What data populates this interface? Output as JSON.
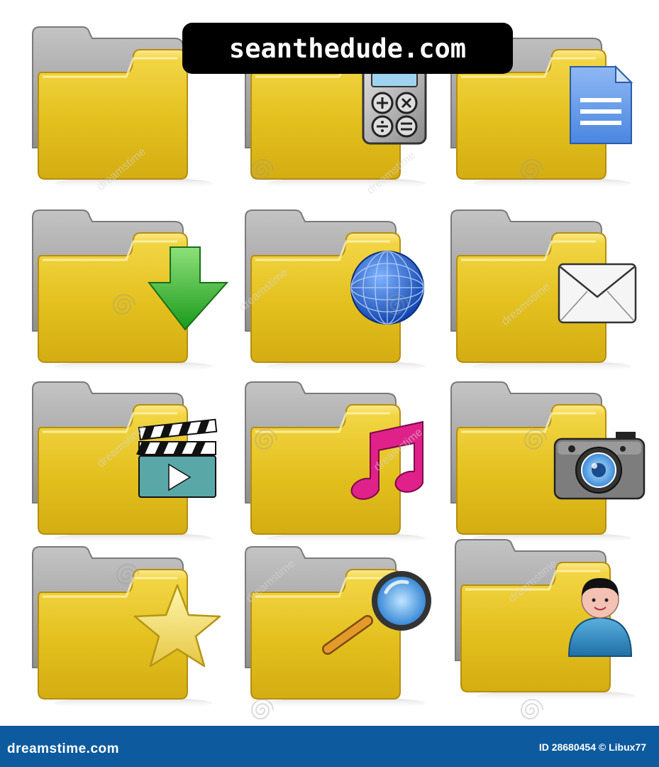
{
  "banner": {
    "text": "seanthedude.com"
  },
  "watermark": {
    "text": "dreamstime"
  },
  "footer": {
    "brand": "dreamstime.com",
    "image_id": "ID 28680454 © Libux77"
  },
  "colors": {
    "folder_front": "#e6c21f",
    "folder_back": "#a9a9a9",
    "footer_bg": "#0d5a9e"
  },
  "icons": [
    {
      "name": "folder-plain-icon",
      "overlay": "none"
    },
    {
      "name": "folder-calculator-icon",
      "overlay": "calculator"
    },
    {
      "name": "folder-document-icon",
      "overlay": "document"
    },
    {
      "name": "folder-download-icon",
      "overlay": "download"
    },
    {
      "name": "folder-globe-icon",
      "overlay": "globe"
    },
    {
      "name": "folder-mail-icon",
      "overlay": "mail"
    },
    {
      "name": "folder-video-icon",
      "overlay": "clapperboard"
    },
    {
      "name": "folder-music-icon",
      "overlay": "music"
    },
    {
      "name": "folder-camera-icon",
      "overlay": "camera"
    },
    {
      "name": "folder-favorites-icon",
      "overlay": "star"
    },
    {
      "name": "folder-search-icon",
      "overlay": "magnifier"
    },
    {
      "name": "folder-user-icon",
      "overlay": "user"
    }
  ]
}
